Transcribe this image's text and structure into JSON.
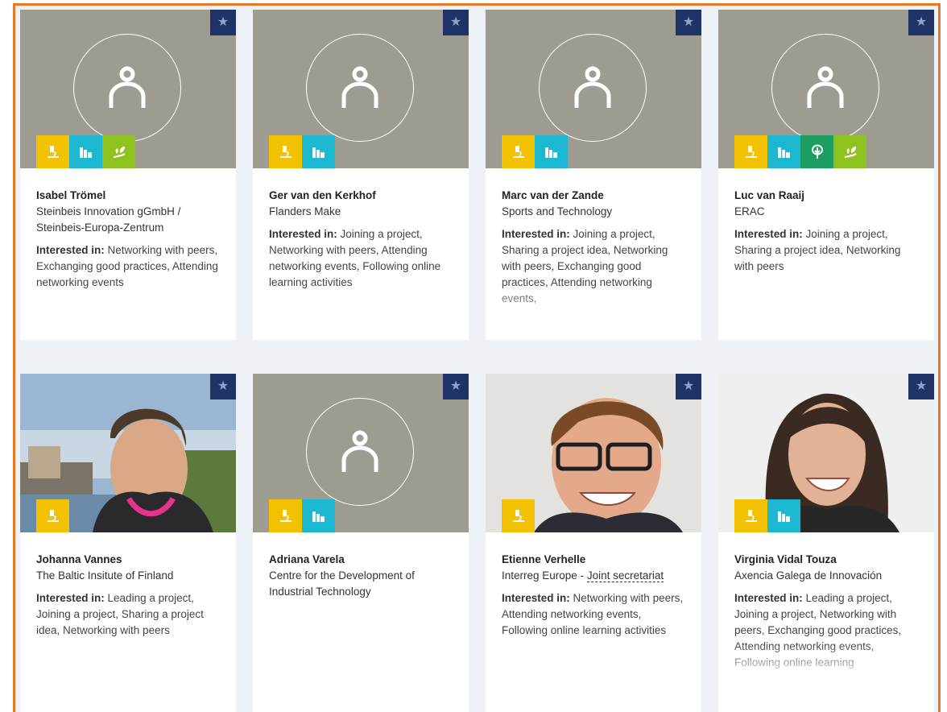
{
  "star_icon": "star-icon",
  "interest_label": "Interested in:",
  "colors": {
    "frame": "#e87722",
    "star_bg": "#1f3466",
    "placeholder_bg": "#9e9c90",
    "yellow": "#f2c200",
    "cyan": "#1cb7d0",
    "green": "#1c9e62",
    "lime": "#8dc21f"
  },
  "people": [
    {
      "name": "Isabel Trömel",
      "org": "Steinbeis Innovation gGmbH / Steinbeis-Europa-Zentrum",
      "interests": "Networking with peers, Exchanging good practices, Attending networking events",
      "tags": [
        "research",
        "industry",
        "environment"
      ]
    },
    {
      "name": "Ger van den Kerkhof",
      "org": "Flanders Make",
      "interests": "Joining a project, Networking with peers, Attending networking events, Following online learning activities",
      "tags": [
        "research",
        "industry"
      ]
    },
    {
      "name": "Marc van der Zande",
      "org": "Sports and Technology",
      "interests": "Joining a project, Sharing a project idea, Networking with peers, Exchanging good practices, Attending networking events,",
      "tags": [
        "research",
        "industry"
      ]
    },
    {
      "name": "Luc van Raaij",
      "org": "ERAC",
      "interests": "Joining a project, Sharing a project idea, Networking with peers",
      "tags": [
        "research",
        "industry",
        "nature",
        "environment"
      ]
    },
    {
      "name": "Johanna Vannes",
      "org": "The Baltic Insitute of Finland",
      "interests": "Leading a project, Joining a project, Sharing a project idea, Networking with peers",
      "tags": [
        "research"
      ]
    },
    {
      "name": "Adriana Varela",
      "org": "Centre for the Development of Industrial Technology",
      "interests": "",
      "tags": [
        "research",
        "industry"
      ]
    },
    {
      "name": "Etienne Verhelle",
      "org_main": "Interreg Europe - ",
      "org_link": "Joint secretariat",
      "interests": "Networking with peers, Attending networking events, Following online learning activities",
      "tags": [
        "research"
      ]
    },
    {
      "name": "Virginia Vidal Touza",
      "org": "Axencia Galega de Innovación",
      "interests": "Leading a project, Joining a project, Networking with peers, Exchanging good practices, Attending networking events, Following online learning",
      "tags": [
        "research",
        "industry"
      ]
    }
  ]
}
